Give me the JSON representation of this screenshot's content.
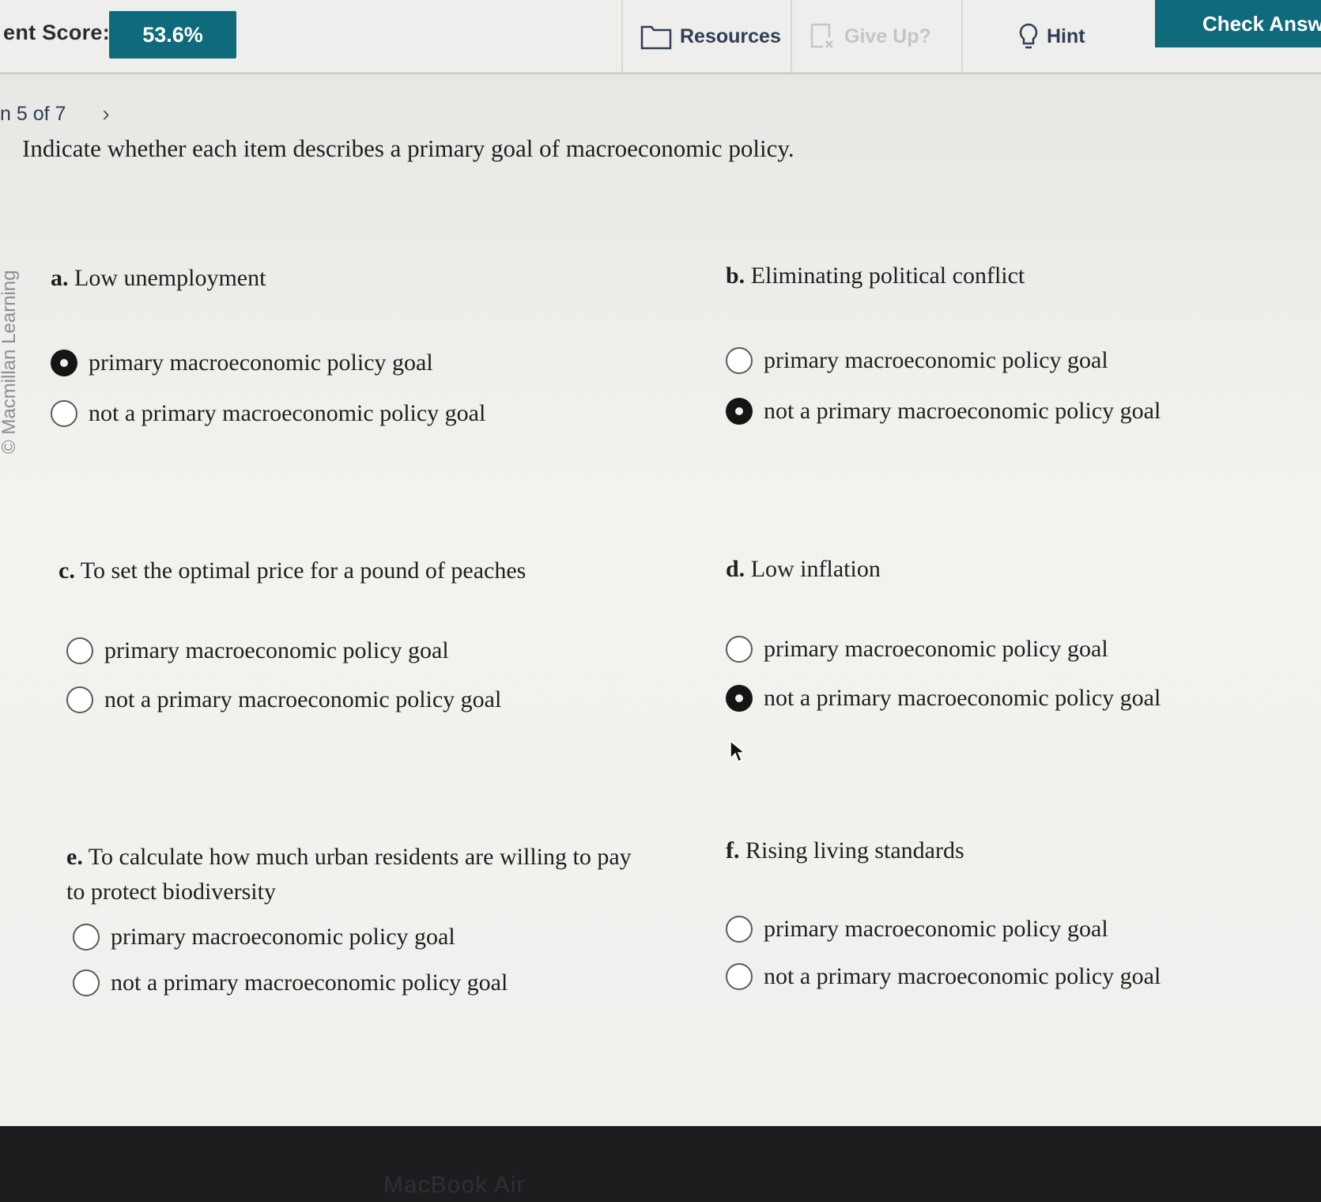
{
  "toolbar": {
    "score_label": "ent Score:",
    "score_value": "53.6%",
    "resources_label": "Resources",
    "giveup_label": "Give Up?",
    "hint_label": "Hint",
    "check_label": "Check Answe"
  },
  "nav": {
    "question_position": "n 5 of 7"
  },
  "prompt": "Indicate whether each item describes a primary goal of macroeconomic policy.",
  "watermark": "© Macmillan Learning",
  "items": [
    {
      "letter": "a.",
      "text": "Low unemployment",
      "options": [
        "primary macroeconomic policy goal",
        "not a primary macroeconomic policy goal"
      ],
      "selected": 0
    },
    {
      "letter": "b.",
      "text": "Eliminating political conflict",
      "options": [
        "primary macroeconomic policy goal",
        "not a primary macroeconomic policy goal"
      ],
      "selected": 1
    },
    {
      "letter": "c.",
      "text": "To set the optimal price for a pound of peaches",
      "options": [
        "primary macroeconomic policy goal",
        "not a primary macroeconomic policy goal"
      ],
      "selected": null
    },
    {
      "letter": "d.",
      "text": "Low inflation",
      "options": [
        "primary macroeconomic policy goal",
        "not a primary macroeconomic policy goal"
      ],
      "selected": 1
    },
    {
      "letter": "e.",
      "text": "To calculate how much urban residents are willing to pay to protect biodiversity",
      "options": [
        "primary macroeconomic policy goal",
        "not a primary macroeconomic policy goal"
      ],
      "selected": null
    },
    {
      "letter": "f.",
      "text": "Rising living standards",
      "options": [
        "primary macroeconomic policy goal",
        "not a primary macroeconomic policy goal"
      ],
      "selected": null
    }
  ],
  "device_label": "MacBook Air"
}
